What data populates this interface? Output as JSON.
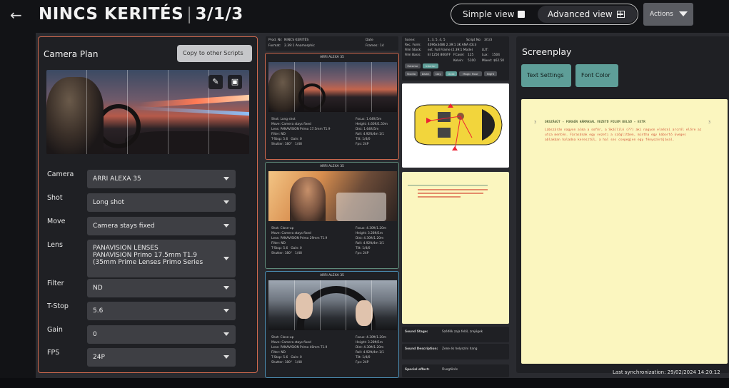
{
  "header": {
    "title": "NINCS KERITÉS",
    "scene_path": "3/1/3",
    "simple_view": "Simple view",
    "advanced_view": "Advanced view",
    "actions": "Actions"
  },
  "camera_plan": {
    "title": "Camera Plan",
    "copy_button": "Copy to other Scripts",
    "fields": [
      {
        "label": "Camera",
        "value": "ARRI ALEXA 35"
      },
      {
        "label": "Shot",
        "value": "Long shot"
      },
      {
        "label": "Move",
        "value": "Camera stays fixed"
      },
      {
        "label": "Lens",
        "value_lines": [
          "PANAVISION LENSES",
          "PANAVISION Primo 17.5mm T1.9",
          "(35mm Prime Lenses Primo Series"
        ]
      },
      {
        "label": "Filter",
        "value": "ND"
      },
      {
        "label": "T-Stop",
        "value": "5.6"
      },
      {
        "label": "Gain",
        "value": "0"
      },
      {
        "label": "FPS",
        "value": "24P"
      }
    ]
  },
  "production": {
    "prod_label": "Prod. Nr:",
    "prod_value": "NINCS KERITÉS",
    "date_label": "Date",
    "format_label": "Format:",
    "format_value": "2.39:1 Anamorphic",
    "frames_label": "Frames:",
    "frames_value": "14"
  },
  "shots": [
    {
      "camera": "ARRI ALEXA 35",
      "shot": "Long shot",
      "move": "Camera stays fixed",
      "lens": "PANAVISION Primo 17.5mm T1.9",
      "filter": "ND",
      "tstop": "5.6",
      "gain": "0",
      "shutter": "180°",
      "iso": "1/48",
      "focus": "1.64ft/5m",
      "height": "4.60ft/1.50m",
      "dist": "1.64ft/5m",
      "roll": "4.92ft/4m 1/1",
      "tilt": "1/4/0",
      "fps": "24P"
    },
    {
      "camera": "ARRI ALEXA 35",
      "shot": "Close-up",
      "move": "Camera stays fixed",
      "lens": "PANAVISION Primo 29mm T1.9",
      "filter": "ND",
      "tstop": "5.6",
      "gain": "0",
      "shutter": "180°",
      "iso": "1/48",
      "focus": "4.30ft/1.20m",
      "height": "3.28ft/1m",
      "dist": "4.30ft/1.20m",
      "roll": "4.92ft/4m 1/1",
      "tilt": "1/4/0",
      "fps": "24P"
    },
    {
      "camera": "ARRI ALEXA 35",
      "shot": "Close-up",
      "move": "Camera stays fixed",
      "lens": "PANAVISION Primo 40mm T1.9",
      "filter": "ND",
      "tstop": "5.6",
      "gain": "0",
      "shutter": "180°",
      "iso": "1/48",
      "focus": "4.30ft/1.20m",
      "height": "3.28ft/1m",
      "dist": "4.30ft/1.20m",
      "roll": "4.92ft/4m 1/1",
      "tilt": "1/4/0",
      "fps": "24P"
    }
  ],
  "shot_labels": {
    "shot": "Shot:",
    "move": "Move:",
    "lens": "Lens:",
    "filter": "Filter:",
    "tstop": "T-Stop:",
    "gain": "Gain:",
    "shutter": "Shutter:",
    "focus": "Focus:",
    "height": "Height:",
    "dist": "Dist:",
    "roll": "Roll:",
    "tilt": "Tilt:",
    "fps": "Fps:"
  },
  "scene_meta": {
    "scene_label": "Scene:",
    "scene_value": "1, 3, 5, 4, 5",
    "script_label": "Script No:",
    "script_value": "3/1/3",
    "rec_label": "Rec. Form:",
    "rec_value": "4096x3486 2.39:1 3K ANA (Dci)",
    "film_label": "Film Stock:",
    "film_value": "ext. Full Frame (2.39:1 Mode)",
    "lut_label": "LUT:",
    "filmbasis_label": "Film Basis:",
    "filmbasis_value": "EI 1250 800/FF",
    "fcasel_label": "FCasel:",
    "fcasel_value": "125",
    "lux_label": "Lux:",
    "lux_value": "1504",
    "kelvin_label": "Kelvin:",
    "kelvin_value": "5100",
    "mixed_label": "Mixed:",
    "mixed_value": "$62.50",
    "tags": [
      "Exterior",
      "Interior",
      "Studio",
      "Dawn",
      "Day",
      "Dusk",
      "Magic Hour",
      "Night"
    ]
  },
  "sound": {
    "stage_label": "Sound Stage:",
    "stage_value": "Szélfék zaja felől, zrejégek",
    "desc_label": "Sound Description:",
    "desc_value": "Zene és helyszíni hang",
    "special_label": "Special effect:",
    "special_value": "Üvegtörés"
  },
  "screenplay": {
    "title": "Screenplay",
    "text_settings": "Text Settings",
    "font_color": "Font Color",
    "scene_number_left": "3",
    "scene_number_right": "3",
    "heading": "ORSZÁGÚT - FORGÓN HÁRMASAL VEZETŐ FÜLEM BELSŐ - EXTR",
    "action": "Lábszárán nagyon alma a sofőr, a Skálliló (??) aki nagyon elnézni arcról előre az utca mentén. Fárasdnak egy vezetı a szöglitben, mintha egy kábortó üveges ablakban haladna keresztül, a hal ses csepegjen egy fényszórójával."
  },
  "status": {
    "sync_label": "Last synchronization:",
    "sync_value": "29/02/2024 14:20:12"
  }
}
